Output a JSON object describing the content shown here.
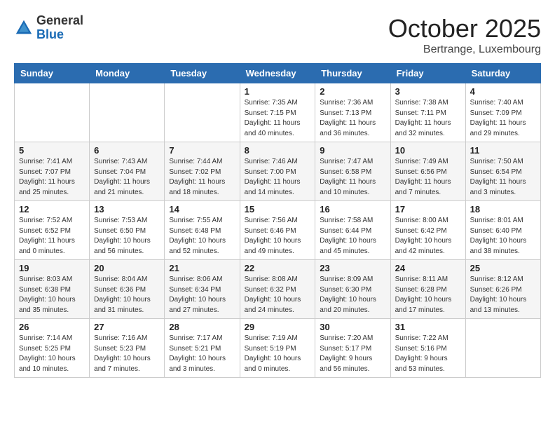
{
  "header": {
    "logo_general": "General",
    "logo_blue": "Blue",
    "month_title": "October 2025",
    "location": "Bertrange, Luxembourg"
  },
  "days_of_week": [
    "Sunday",
    "Monday",
    "Tuesday",
    "Wednesday",
    "Thursday",
    "Friday",
    "Saturday"
  ],
  "weeks": [
    [
      {
        "day": "",
        "info": ""
      },
      {
        "day": "",
        "info": ""
      },
      {
        "day": "",
        "info": ""
      },
      {
        "day": "1",
        "info": "Sunrise: 7:35 AM\nSunset: 7:15 PM\nDaylight: 11 hours\nand 40 minutes."
      },
      {
        "day": "2",
        "info": "Sunrise: 7:36 AM\nSunset: 7:13 PM\nDaylight: 11 hours\nand 36 minutes."
      },
      {
        "day": "3",
        "info": "Sunrise: 7:38 AM\nSunset: 7:11 PM\nDaylight: 11 hours\nand 32 minutes."
      },
      {
        "day": "4",
        "info": "Sunrise: 7:40 AM\nSunset: 7:09 PM\nDaylight: 11 hours\nand 29 minutes."
      }
    ],
    [
      {
        "day": "5",
        "info": "Sunrise: 7:41 AM\nSunset: 7:07 PM\nDaylight: 11 hours\nand 25 minutes."
      },
      {
        "day": "6",
        "info": "Sunrise: 7:43 AM\nSunset: 7:04 PM\nDaylight: 11 hours\nand 21 minutes."
      },
      {
        "day": "7",
        "info": "Sunrise: 7:44 AM\nSunset: 7:02 PM\nDaylight: 11 hours\nand 18 minutes."
      },
      {
        "day": "8",
        "info": "Sunrise: 7:46 AM\nSunset: 7:00 PM\nDaylight: 11 hours\nand 14 minutes."
      },
      {
        "day": "9",
        "info": "Sunrise: 7:47 AM\nSunset: 6:58 PM\nDaylight: 11 hours\nand 10 minutes."
      },
      {
        "day": "10",
        "info": "Sunrise: 7:49 AM\nSunset: 6:56 PM\nDaylight: 11 hours\nand 7 minutes."
      },
      {
        "day": "11",
        "info": "Sunrise: 7:50 AM\nSunset: 6:54 PM\nDaylight: 11 hours\nand 3 minutes."
      }
    ],
    [
      {
        "day": "12",
        "info": "Sunrise: 7:52 AM\nSunset: 6:52 PM\nDaylight: 11 hours\nand 0 minutes."
      },
      {
        "day": "13",
        "info": "Sunrise: 7:53 AM\nSunset: 6:50 PM\nDaylight: 10 hours\nand 56 minutes."
      },
      {
        "day": "14",
        "info": "Sunrise: 7:55 AM\nSunset: 6:48 PM\nDaylight: 10 hours\nand 52 minutes."
      },
      {
        "day": "15",
        "info": "Sunrise: 7:56 AM\nSunset: 6:46 PM\nDaylight: 10 hours\nand 49 minutes."
      },
      {
        "day": "16",
        "info": "Sunrise: 7:58 AM\nSunset: 6:44 PM\nDaylight: 10 hours\nand 45 minutes."
      },
      {
        "day": "17",
        "info": "Sunrise: 8:00 AM\nSunset: 6:42 PM\nDaylight: 10 hours\nand 42 minutes."
      },
      {
        "day": "18",
        "info": "Sunrise: 8:01 AM\nSunset: 6:40 PM\nDaylight: 10 hours\nand 38 minutes."
      }
    ],
    [
      {
        "day": "19",
        "info": "Sunrise: 8:03 AM\nSunset: 6:38 PM\nDaylight: 10 hours\nand 35 minutes."
      },
      {
        "day": "20",
        "info": "Sunrise: 8:04 AM\nSunset: 6:36 PM\nDaylight: 10 hours\nand 31 minutes."
      },
      {
        "day": "21",
        "info": "Sunrise: 8:06 AM\nSunset: 6:34 PM\nDaylight: 10 hours\nand 27 minutes."
      },
      {
        "day": "22",
        "info": "Sunrise: 8:08 AM\nSunset: 6:32 PM\nDaylight: 10 hours\nand 24 minutes."
      },
      {
        "day": "23",
        "info": "Sunrise: 8:09 AM\nSunset: 6:30 PM\nDaylight: 10 hours\nand 20 minutes."
      },
      {
        "day": "24",
        "info": "Sunrise: 8:11 AM\nSunset: 6:28 PM\nDaylight: 10 hours\nand 17 minutes."
      },
      {
        "day": "25",
        "info": "Sunrise: 8:12 AM\nSunset: 6:26 PM\nDaylight: 10 hours\nand 13 minutes."
      }
    ],
    [
      {
        "day": "26",
        "info": "Sunrise: 7:14 AM\nSunset: 5:25 PM\nDaylight: 10 hours\nand 10 minutes."
      },
      {
        "day": "27",
        "info": "Sunrise: 7:16 AM\nSunset: 5:23 PM\nDaylight: 10 hours\nand 7 minutes."
      },
      {
        "day": "28",
        "info": "Sunrise: 7:17 AM\nSunset: 5:21 PM\nDaylight: 10 hours\nand 3 minutes."
      },
      {
        "day": "29",
        "info": "Sunrise: 7:19 AM\nSunset: 5:19 PM\nDaylight: 10 hours\nand 0 minutes."
      },
      {
        "day": "30",
        "info": "Sunrise: 7:20 AM\nSunset: 5:17 PM\nDaylight: 9 hours\nand 56 minutes."
      },
      {
        "day": "31",
        "info": "Sunrise: 7:22 AM\nSunset: 5:16 PM\nDaylight: 9 hours\nand 53 minutes."
      },
      {
        "day": "",
        "info": ""
      }
    ]
  ]
}
